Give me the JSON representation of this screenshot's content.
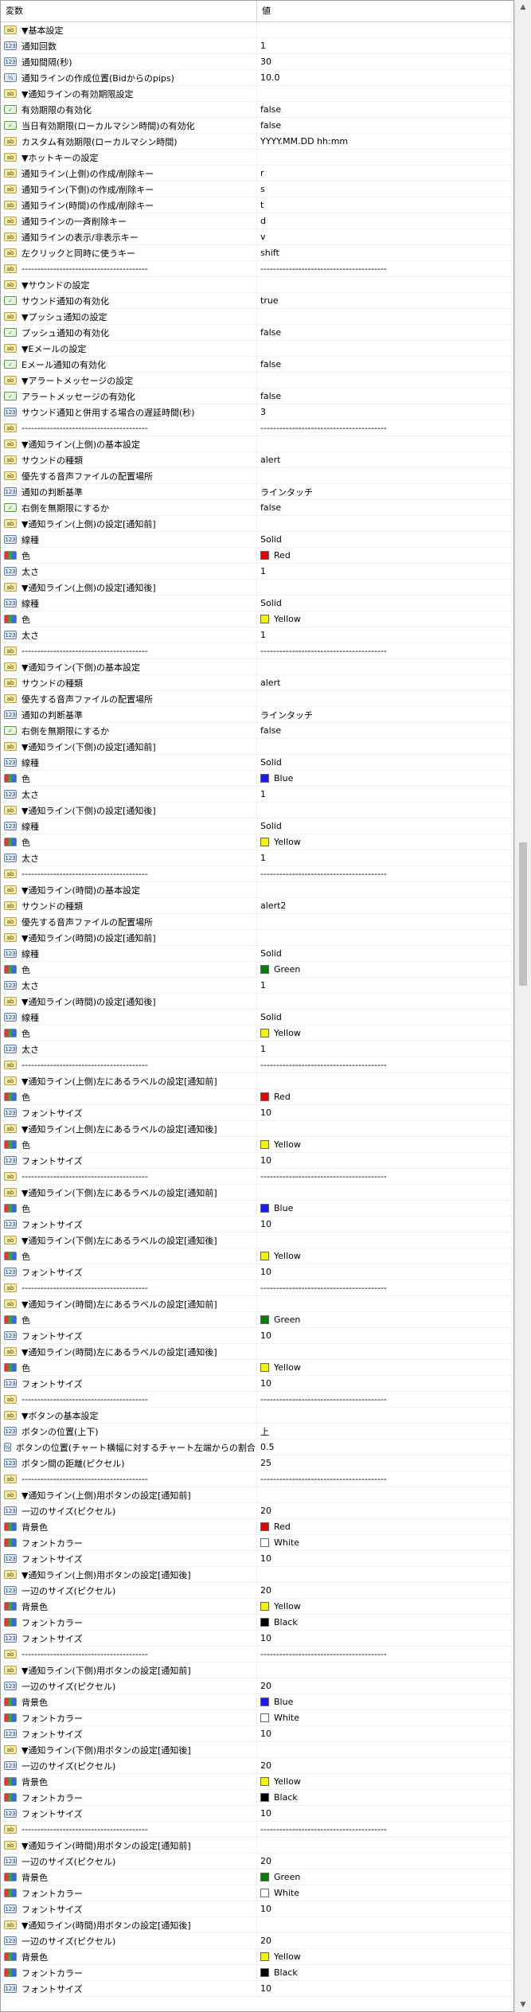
{
  "header": {
    "col1": "変数",
    "col2": "値"
  },
  "rows": [
    {
      "n": "▼基本設定",
      "v": "",
      "t": "ab"
    },
    {
      "n": "通知回数",
      "v": "1",
      "t": "123"
    },
    {
      "n": "通知間隔(秒)",
      "v": "30",
      "t": "123"
    },
    {
      "n": "通知ラインの作成位置(Bidからのpips)",
      "v": "10.0",
      "t": "v2"
    },
    {
      "n": "▼通知ラインの有効期限設定",
      "v": "",
      "t": "ab"
    },
    {
      "n": "有効期限の有効化",
      "v": "false",
      "t": "bool"
    },
    {
      "n": "当日有効期限(ローカルマシン時間)の有効化",
      "v": "false",
      "t": "bool"
    },
    {
      "n": "カスタム有効期限(ローカルマシン時間)",
      "v": "YYYY.MM.DD hh:mm",
      "t": "ab"
    },
    {
      "n": "▼ホットキーの設定",
      "v": "",
      "t": "ab"
    },
    {
      "n": "通知ライン(上側)の作成/削除キー",
      "v": "r",
      "t": "ab"
    },
    {
      "n": "通知ライン(下側)の作成/削除キー",
      "v": "s",
      "t": "ab"
    },
    {
      "n": "通知ライン(時間)の作成/削除キー",
      "v": "t",
      "t": "ab"
    },
    {
      "n": "通知ラインの一斉削除キー",
      "v": "d",
      "t": "ab"
    },
    {
      "n": "通知ラインの表示/非表示キー",
      "v": "v",
      "t": "ab"
    },
    {
      "n": "左クリックと同時に使うキー",
      "v": "shift",
      "t": "ab"
    },
    {
      "n": "----------------------------------------",
      "v": "----------------------------------------",
      "t": "ab"
    },
    {
      "n": "▼サウンドの設定",
      "v": "",
      "t": "ab"
    },
    {
      "n": "サウンド通知の有効化",
      "v": "true",
      "t": "bool"
    },
    {
      "n": "▼プッシュ通知の設定",
      "v": "",
      "t": "ab"
    },
    {
      "n": "プッシュ通知の有効化",
      "v": "false",
      "t": "bool"
    },
    {
      "n": "▼Eメールの設定",
      "v": "",
      "t": "ab"
    },
    {
      "n": "Eメール通知の有効化",
      "v": "false",
      "t": "bool"
    },
    {
      "n": "▼アラートメッセージの設定",
      "v": "",
      "t": "ab"
    },
    {
      "n": "アラートメッセージの有効化",
      "v": "false",
      "t": "bool"
    },
    {
      "n": "サウンド通知と併用する場合の遅延時間(秒)",
      "v": "3",
      "t": "123"
    },
    {
      "n": "----------------------------------------",
      "v": "----------------------------------------",
      "t": "ab"
    },
    {
      "n": "▼通知ライン(上側)の基本設定",
      "v": "",
      "t": "ab"
    },
    {
      "n": "サウンドの種類",
      "v": "alert",
      "t": "ab"
    },
    {
      "n": "優先する音声ファイルの配置場所",
      "v": "",
      "t": "ab"
    },
    {
      "n": "通知の判断基準",
      "v": "ラインタッチ",
      "t": "123"
    },
    {
      "n": "右側を無期限にするか",
      "v": "false",
      "t": "bool"
    },
    {
      "n": "▼通知ライン(上側)の設定[通知前]",
      "v": "",
      "t": "ab"
    },
    {
      "n": "線種",
      "v": "Solid",
      "t": "123"
    },
    {
      "n": "色",
      "v": "Red",
      "t": "color",
      "c": "#e60000"
    },
    {
      "n": "太さ",
      "v": "1",
      "t": "123"
    },
    {
      "n": "▼通知ライン(上側)の設定[通知後]",
      "v": "",
      "t": "ab"
    },
    {
      "n": "線種",
      "v": "Solid",
      "t": "123"
    },
    {
      "n": "色",
      "v": "Yellow",
      "t": "color",
      "c": "#f5f500"
    },
    {
      "n": "太さ",
      "v": "1",
      "t": "123"
    },
    {
      "n": "----------------------------------------",
      "v": "----------------------------------------",
      "t": "ab"
    },
    {
      "n": "▼通知ライン(下側)の基本設定",
      "v": "",
      "t": "ab"
    },
    {
      "n": "サウンドの種類",
      "v": "alert",
      "t": "ab"
    },
    {
      "n": "優先する音声ファイルの配置場所",
      "v": "",
      "t": "ab"
    },
    {
      "n": "通知の判断基準",
      "v": "ラインタッチ",
      "t": "123"
    },
    {
      "n": "右側を無期限にするか",
      "v": "false",
      "t": "bool"
    },
    {
      "n": "▼通知ライン(下側)の設定[通知前]",
      "v": "",
      "t": "ab"
    },
    {
      "n": "線種",
      "v": "Solid",
      "t": "123"
    },
    {
      "n": "色",
      "v": "Blue",
      "t": "color",
      "c": "#1a1aff"
    },
    {
      "n": "太さ",
      "v": "1",
      "t": "123"
    },
    {
      "n": "▼通知ライン(下側)の設定[通知後]",
      "v": "",
      "t": "ab"
    },
    {
      "n": "線種",
      "v": "Solid",
      "t": "123"
    },
    {
      "n": "色",
      "v": "Yellow",
      "t": "color",
      "c": "#f5f500"
    },
    {
      "n": "太さ",
      "v": "1",
      "t": "123"
    },
    {
      "n": "----------------------------------------",
      "v": "----------------------------------------",
      "t": "ab"
    },
    {
      "n": "▼通知ライン(時間)の基本設定",
      "v": "",
      "t": "ab"
    },
    {
      "n": "サウンドの種類",
      "v": "alert2",
      "t": "ab"
    },
    {
      "n": "優先する音声ファイルの配置場所",
      "v": "",
      "t": "ab"
    },
    {
      "n": "▼通知ライン(時間)の設定[通知前]",
      "v": "",
      "t": "ab"
    },
    {
      "n": "線種",
      "v": "Solid",
      "t": "123"
    },
    {
      "n": "色",
      "v": "Green",
      "t": "color",
      "c": "#008000"
    },
    {
      "n": "太さ",
      "v": "1",
      "t": "123"
    },
    {
      "n": "▼通知ライン(時間)の設定[通知後]",
      "v": "",
      "t": "ab"
    },
    {
      "n": "線種",
      "v": "Solid",
      "t": "123"
    },
    {
      "n": "色",
      "v": "Yellow",
      "t": "color",
      "c": "#f5f500"
    },
    {
      "n": "太さ",
      "v": "1",
      "t": "123"
    },
    {
      "n": "----------------------------------------",
      "v": "----------------------------------------",
      "t": "ab"
    },
    {
      "n": "▼通知ライン(上側)左にあるラベルの設定[通知前]",
      "v": "",
      "t": "ab"
    },
    {
      "n": "色",
      "v": "Red",
      "t": "color",
      "c": "#e60000"
    },
    {
      "n": "フォントサイズ",
      "v": "10",
      "t": "123"
    },
    {
      "n": "▼通知ライン(上側)左にあるラベルの設定[通知後]",
      "v": "",
      "t": "ab"
    },
    {
      "n": "色",
      "v": "Yellow",
      "t": "color",
      "c": "#f5f500"
    },
    {
      "n": "フォントサイズ",
      "v": "10",
      "t": "123"
    },
    {
      "n": "----------------------------------------",
      "v": "----------------------------------------",
      "t": "ab"
    },
    {
      "n": "▼通知ライン(下側)左にあるラベルの設定[通知前]",
      "v": "",
      "t": "ab"
    },
    {
      "n": "色",
      "v": "Blue",
      "t": "color",
      "c": "#1a1aff"
    },
    {
      "n": "フォントサイズ",
      "v": "10",
      "t": "123"
    },
    {
      "n": "▼通知ライン(下側)左にあるラベルの設定[通知後]",
      "v": "",
      "t": "ab"
    },
    {
      "n": "色",
      "v": "Yellow",
      "t": "color",
      "c": "#f5f500"
    },
    {
      "n": "フォントサイズ",
      "v": "10",
      "t": "123"
    },
    {
      "n": "----------------------------------------",
      "v": "----------------------------------------",
      "t": "ab"
    },
    {
      "n": "▼通知ライン(時間)左にあるラベルの設定[通知前]",
      "v": "",
      "t": "ab"
    },
    {
      "n": "色",
      "v": "Green",
      "t": "color",
      "c": "#008000"
    },
    {
      "n": "フォントサイズ",
      "v": "10",
      "t": "123"
    },
    {
      "n": "▼通知ライン(時間)左にあるラベルの設定[通知後]",
      "v": "",
      "t": "ab"
    },
    {
      "n": "色",
      "v": "Yellow",
      "t": "color",
      "c": "#f5f500"
    },
    {
      "n": "フォントサイズ",
      "v": "10",
      "t": "123"
    },
    {
      "n": "----------------------------------------",
      "v": "----------------------------------------",
      "t": "ab"
    },
    {
      "n": "▼ボタンの基本設定",
      "v": "",
      "t": "ab"
    },
    {
      "n": "ボタンの位置(上下)",
      "v": "上",
      "t": "123"
    },
    {
      "n": "ボタンの位置(チャート横幅に対するチャート左端からの割合)",
      "v": "0.5",
      "t": "v2"
    },
    {
      "n": "ボタン間の距離(ピクセル)",
      "v": "25",
      "t": "123"
    },
    {
      "n": "----------------------------------------",
      "v": "----------------------------------------",
      "t": "ab"
    },
    {
      "n": "▼通知ライン(上側)用ボタンの設定[通知前]",
      "v": "",
      "t": "ab"
    },
    {
      "n": "一辺のサイズ(ピクセル)",
      "v": "20",
      "t": "123"
    },
    {
      "n": "背景色",
      "v": "Red",
      "t": "color",
      "c": "#e60000"
    },
    {
      "n": "フォントカラー",
      "v": "White",
      "t": "color",
      "c": "#ffffff"
    },
    {
      "n": "フォントサイズ",
      "v": "10",
      "t": "123"
    },
    {
      "n": "▼通知ライン(上側)用ボタンの設定[通知後]",
      "v": "",
      "t": "ab"
    },
    {
      "n": "一辺のサイズ(ピクセル)",
      "v": "20",
      "t": "123"
    },
    {
      "n": "背景色",
      "v": "Yellow",
      "t": "color",
      "c": "#f5f500"
    },
    {
      "n": "フォントカラー",
      "v": "Black",
      "t": "color",
      "c": "#000000"
    },
    {
      "n": "フォントサイズ",
      "v": "10",
      "t": "123"
    },
    {
      "n": "----------------------------------------",
      "v": "----------------------------------------",
      "t": "ab"
    },
    {
      "n": "▼通知ライン(下側)用ボタンの設定[通知前]",
      "v": "",
      "t": "ab"
    },
    {
      "n": "一辺のサイズ(ピクセル)",
      "v": "20",
      "t": "123"
    },
    {
      "n": "背景色",
      "v": "Blue",
      "t": "color",
      "c": "#1a1aff"
    },
    {
      "n": "フォントカラー",
      "v": "White",
      "t": "color",
      "c": "#ffffff"
    },
    {
      "n": "フォントサイズ",
      "v": "10",
      "t": "123"
    },
    {
      "n": "▼通知ライン(下側)用ボタンの設定[通知後]",
      "v": "",
      "t": "ab"
    },
    {
      "n": "一辺のサイズ(ピクセル)",
      "v": "20",
      "t": "123"
    },
    {
      "n": "背景色",
      "v": "Yellow",
      "t": "color",
      "c": "#f5f500"
    },
    {
      "n": "フォントカラー",
      "v": "Black",
      "t": "color",
      "c": "#000000"
    },
    {
      "n": "フォントサイズ",
      "v": "10",
      "t": "123"
    },
    {
      "n": "----------------------------------------",
      "v": "----------------------------------------",
      "t": "ab"
    },
    {
      "n": "▼通知ライン(時間)用ボタンの設定[通知前]",
      "v": "",
      "t": "ab"
    },
    {
      "n": "一辺のサイズ(ピクセル)",
      "v": "20",
      "t": "123"
    },
    {
      "n": "背景色",
      "v": "Green",
      "t": "color",
      "c": "#008000"
    },
    {
      "n": "フォントカラー",
      "v": "White",
      "t": "color",
      "c": "#ffffff"
    },
    {
      "n": "フォントサイズ",
      "v": "10",
      "t": "123"
    },
    {
      "n": "▼通知ライン(時間)用ボタンの設定[通知後]",
      "v": "",
      "t": "ab"
    },
    {
      "n": "一辺のサイズ(ピクセル)",
      "v": "20",
      "t": "123"
    },
    {
      "n": "背景色",
      "v": "Yellow",
      "t": "color",
      "c": "#f5f500"
    },
    {
      "n": "フォントカラー",
      "v": "Black",
      "t": "color",
      "c": "#000000"
    },
    {
      "n": "フォントサイズ",
      "v": "10",
      "t": "123"
    }
  ],
  "icons": {
    "ab": "ab",
    "123": "123",
    "v2": "½",
    "bool": "✓",
    "color": ""
  },
  "scrollbar": {
    "up": "▲",
    "down": "▼",
    "position": 0.45
  }
}
